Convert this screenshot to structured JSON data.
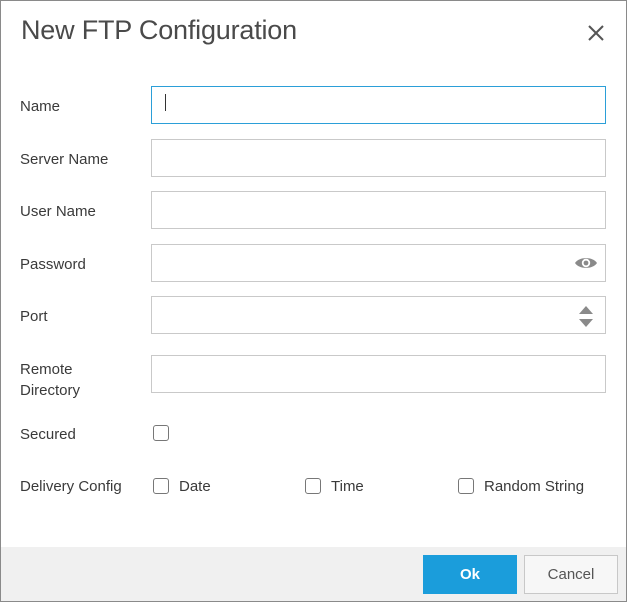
{
  "dialog": {
    "title": "New FTP Configuration",
    "close_icon": "close-icon"
  },
  "form": {
    "name": {
      "label": "Name",
      "value": ""
    },
    "server_name": {
      "label": "Server Name",
      "value": ""
    },
    "user_name": {
      "label": "User Name",
      "value": ""
    },
    "password": {
      "label": "Password",
      "value": "",
      "icon": "eye-icon"
    },
    "port": {
      "label": "Port",
      "value": "",
      "icons": [
        "spinner-up-icon",
        "spinner-down-icon"
      ]
    },
    "remote_directory": {
      "label_line1": "Remote",
      "label_line2": "Directory",
      "value": ""
    },
    "secured": {
      "label": "Secured",
      "checked": false
    },
    "delivery_config": {
      "label": "Delivery Config",
      "options": [
        {
          "label": "Date",
          "checked": false
        },
        {
          "label": "Time",
          "checked": false
        },
        {
          "label": "Random String",
          "checked": false
        }
      ]
    }
  },
  "footer": {
    "ok_label": "Ok",
    "cancel_label": "Cancel"
  },
  "colors": {
    "accent": "#1b9ddb",
    "focus_border": "#2b9fd8",
    "footer_bg": "#f0f0f0"
  }
}
